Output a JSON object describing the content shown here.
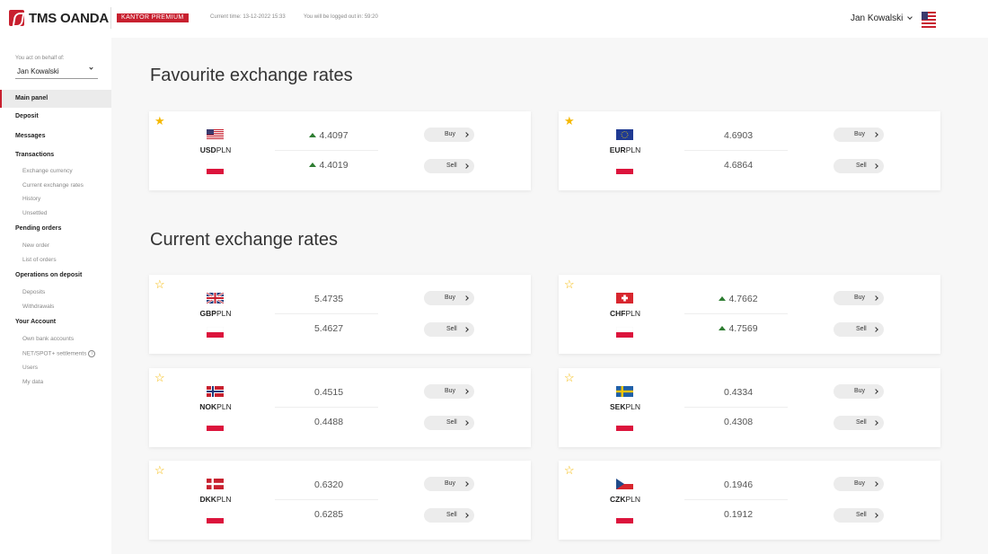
{
  "header": {
    "brand": "TMS OANDA",
    "badge": "KANTOR PREMIUM",
    "current_time": "Current time: 13-12-2022 15:33",
    "logout_info": "You will be logged out in: 59:20",
    "user_name": "Jan Kowalski",
    "language_flag": "us-flag-icon"
  },
  "sidebar": {
    "behalf_label": "You act on behalf of:",
    "behalf_value": "Jan Kowalski",
    "items": [
      {
        "label": "Main panel",
        "type": "main",
        "active": true
      },
      {
        "label": "Deposit",
        "type": "main"
      },
      {
        "label": "Messages",
        "type": "main"
      },
      {
        "label": "Transactions",
        "type": "main"
      },
      {
        "label": "Exchange currency",
        "type": "sub"
      },
      {
        "label": "Current exchange rates",
        "type": "sub"
      },
      {
        "label": "History",
        "type": "sub"
      },
      {
        "label": "Unsettled",
        "type": "sub"
      },
      {
        "label": "Pending orders",
        "type": "main"
      },
      {
        "label": "New order",
        "type": "sub"
      },
      {
        "label": "List of orders",
        "type": "sub"
      },
      {
        "label": "Operations on deposit",
        "type": "main"
      },
      {
        "label": "Deposits",
        "type": "sub"
      },
      {
        "label": "Withdrawals",
        "type": "sub"
      },
      {
        "label": "Your Account",
        "type": "main"
      },
      {
        "label": "Own bank accounts",
        "type": "sub"
      },
      {
        "label": "NET/SPOT+ settlements",
        "type": "sub",
        "info": true
      },
      {
        "label": "Users",
        "type": "sub"
      },
      {
        "label": "My data",
        "type": "sub"
      }
    ]
  },
  "sections": {
    "favourite_title": "Favourite exchange rates",
    "current_title": "Current exchange rates"
  },
  "buttons": {
    "buy": "Buy",
    "sell": "Sell"
  },
  "favourites": [
    {
      "base": "USD",
      "quote": "PLN",
      "flag": "us-flag-icon",
      "buy_rate": "4.4097",
      "sell_rate": "4.4019",
      "up": true,
      "starred": true
    },
    {
      "base": "EUR",
      "quote": "PLN",
      "flag": "eu-flag-icon",
      "buy_rate": "4.6903",
      "sell_rate": "4.6864",
      "up": false,
      "starred": true
    }
  ],
  "rates": [
    {
      "base": "GBP",
      "quote": "PLN",
      "flag": "gb-flag-icon",
      "buy_rate": "5.4735",
      "sell_rate": "5.4627",
      "up": false,
      "starred": false
    },
    {
      "base": "CHF",
      "quote": "PLN",
      "flag": "ch-flag-icon",
      "buy_rate": "4.7662",
      "sell_rate": "4.7569",
      "up": true,
      "starred": false
    },
    {
      "base": "NOK",
      "quote": "PLN",
      "flag": "no-flag-icon",
      "buy_rate": "0.4515",
      "sell_rate": "0.4488",
      "up": false,
      "starred": false
    },
    {
      "base": "SEK",
      "quote": "PLN",
      "flag": "se-flag-icon",
      "buy_rate": "0.4334",
      "sell_rate": "0.4308",
      "up": false,
      "starred": false
    },
    {
      "base": "DKK",
      "quote": "PLN",
      "flag": "dk-flag-icon",
      "buy_rate": "0.6320",
      "sell_rate": "0.6285",
      "up": false,
      "starred": false
    },
    {
      "base": "CZK",
      "quote": "PLN",
      "flag": "cz-flag-icon",
      "buy_rate": "0.1946",
      "sell_rate": "0.1912",
      "up": false,
      "starred": false
    }
  ],
  "colors": {
    "brand": "#c8202f",
    "up": "#2e7d32",
    "star": "#f5b800"
  }
}
